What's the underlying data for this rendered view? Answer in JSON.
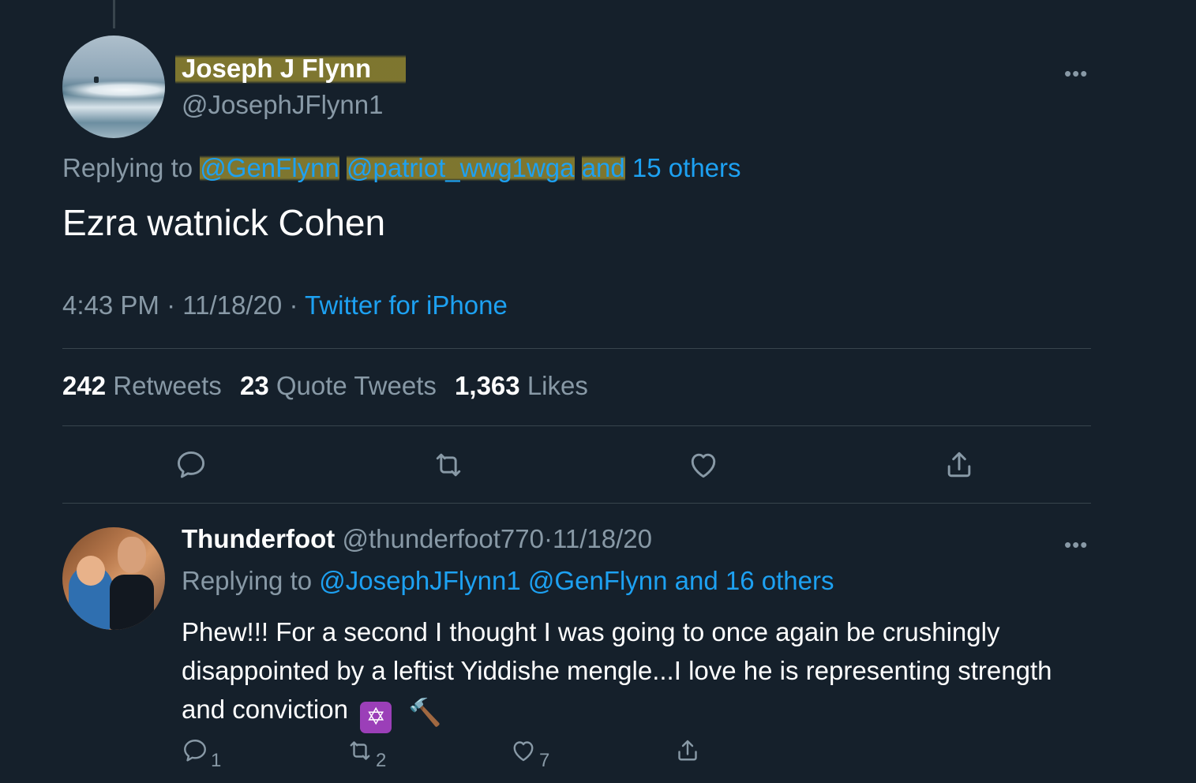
{
  "main_tweet": {
    "author_name": "Joseph J Flynn",
    "author_handle": "@JosephJFlynn1",
    "more_label": "•••",
    "replying_prefix": "Replying to",
    "replying_mentions": [
      "@GenFlynn",
      "@patriot_wwg1wga"
    ],
    "replying_and": "and",
    "replying_others": "15 others",
    "text": "Ezra watnick Cohen",
    "time": "4:43 PM",
    "date": "11/18/20",
    "separator": "·",
    "source": "Twitter for iPhone",
    "stats": {
      "retweets_count": "242",
      "retweets_label": "Retweets",
      "quotes_count": "23",
      "quotes_label": "Quote Tweets",
      "likes_count": "1,363",
      "likes_label": "Likes"
    },
    "actions": [
      "comment-icon",
      "retweet-icon",
      "heart-icon",
      "share-icon"
    ]
  },
  "reply_tweet": {
    "author_name": "Thunderfoot",
    "author_handle": "@thunderfoot770",
    "separator": "·",
    "date": "11/18/20",
    "more_label": "•••",
    "replying_prefix": "Replying to",
    "replying_mentions": [
      "@JosephJFlynn1",
      "@GenFlynn"
    ],
    "replying_others": "and 16 others",
    "text": "Phew!!! For a second I thought I was going to once again be crushingly disappointed by a leftist Yiddishe mengle...I love he is representing strength and conviction",
    "emoji_star": "✡",
    "emoji_hammer": "🔨",
    "reply_count": "1",
    "retweet_count": "2",
    "like_count": "7"
  },
  "colors": {
    "background": "#15202b",
    "divider": "#38444d",
    "secondary_text": "#8899a6",
    "link": "#1da1f2",
    "highlight": "#bea532"
  }
}
